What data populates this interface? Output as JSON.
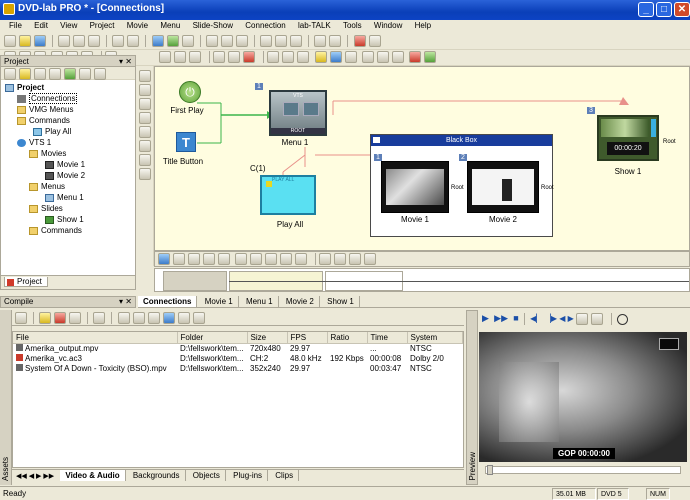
{
  "window": {
    "title": "DVD-lab PRO * - [Connections]"
  },
  "menu": [
    "File",
    "Edit",
    "View",
    "Project",
    "Movie",
    "Menu",
    "Slide-Show",
    "Connection",
    "lab-TALK",
    "Tools",
    "Window",
    "Help"
  ],
  "project_panel": {
    "title": "Project",
    "tab": "Project",
    "tree": {
      "root": "Project",
      "connections": "Connections",
      "vmg_menus": "VMG Menus",
      "commands": "Commands",
      "play_all": "Play All",
      "vts": "VTS 1",
      "movies": "Movies",
      "movie1": "Movie 1",
      "movie2": "Movie 2",
      "menus": "Menus",
      "menu1": "Menu 1",
      "slides": "Slides",
      "show1": "Show 1",
      "commands2": "Commands"
    }
  },
  "canvas": {
    "first_play": "First Play",
    "title_button": "Title Button",
    "menu_num": "1",
    "menu_label": "Menu 1",
    "menu_top": "VTS",
    "menu_root": "ROOT",
    "playall_badge": "C(1)",
    "playall_label": "Play All",
    "playall_top": "PLAY ALL",
    "blackbox_title": "Black Box",
    "movie1_num": "1",
    "movie1_label": "Movie 1",
    "movie1_root": "Root",
    "movie2_num": "2",
    "movie2_label": "Movie 2",
    "movie2_root": "Root",
    "show_num": "3",
    "show_label": "Show 1",
    "show_time": "00:00:20",
    "show_root": "Root"
  },
  "compile_panel": {
    "title": "Compile"
  },
  "doc_tabs": [
    "Connections",
    "Movie 1",
    "Menu 1",
    "Movie 2",
    "Show 1"
  ],
  "assets": {
    "side_label": "Assets",
    "columns": [
      "File",
      "Folder",
      "Size",
      "FPS",
      "Ratio",
      "Time",
      "System"
    ],
    "rows": [
      {
        "file": "Amerika_output.mpv",
        "folder": "D:\\fellswork\\tem...",
        "size": "720x480",
        "fps": "29.97",
        "ratio": "",
        "time": "...",
        "system": "NTSC"
      },
      {
        "file": "Amerika_vc.ac3",
        "folder": "D:\\fellswork\\tem...",
        "size": "CH:2",
        "fps": "48.0 kHz",
        "ratio": "192 Kbps",
        "time": "00:00:08",
        "system": "Dolby 2/0"
      },
      {
        "file": "System Of A Down - Toxicity (BSO).mpv",
        "folder": "D:\\fellswork\\tem...",
        "size": "352x240",
        "fps": "29.97",
        "ratio": "",
        "time": "00:03:47",
        "system": "NTSC"
      }
    ],
    "tabs": [
      "Video & Audio",
      "Backgrounds",
      "Objects",
      "Plug-ins",
      "Clips"
    ]
  },
  "preview": {
    "side_label": "Preview",
    "gop": "GOP 00:00:00"
  },
  "status": {
    "left": "Ready",
    "size": "35.01 MB",
    "disc": "DVD 5",
    "num": "NUM"
  },
  "colors": {
    "title_bar": "#0a3fb8",
    "canvas_bg": "#fffde0",
    "node_blue": "#5aa9e6",
    "arrow_green": "#3bb54a"
  }
}
